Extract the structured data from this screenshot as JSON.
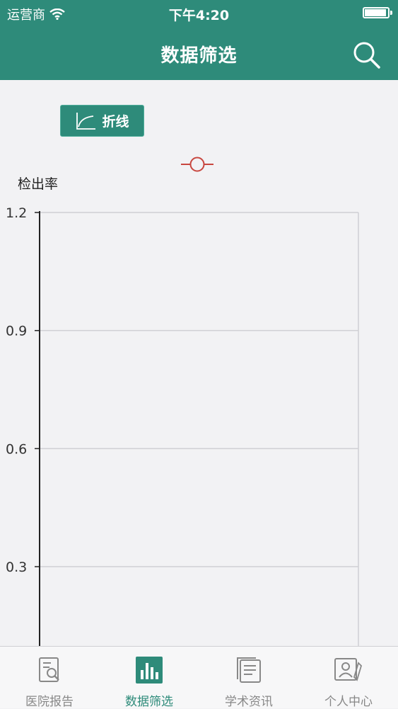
{
  "status_bar": {
    "carrier": "运营商",
    "time": "下午4:20",
    "battery_level": 0.95
  },
  "nav": {
    "title": "数据筛选",
    "search_icon": "search-icon"
  },
  "chart_type_button": {
    "label": "折线",
    "icon": "line-chart-icon"
  },
  "colors": {
    "accent": "#2e8b7a",
    "series": "#c8473f",
    "grid": "#cfcfd4",
    "axis": "#222222",
    "tab_inactive": "#888888"
  },
  "chart_data": {
    "type": "line",
    "ylabel": "检出率",
    "yticks": [
      "1.2",
      "0.9",
      "0.6",
      "0.3"
    ],
    "ylim": [
      0,
      1.2
    ],
    "series": [],
    "legend": "top-center",
    "grid": true
  },
  "tabs": [
    {
      "label": "医院报告",
      "icon": "report-search-icon",
      "active": false
    },
    {
      "label": "数据筛选",
      "icon": "bar-chart-icon",
      "active": true
    },
    {
      "label": "学术资讯",
      "icon": "news-document-icon",
      "active": false
    },
    {
      "label": "个人中心",
      "icon": "profile-card-icon",
      "active": false
    }
  ]
}
